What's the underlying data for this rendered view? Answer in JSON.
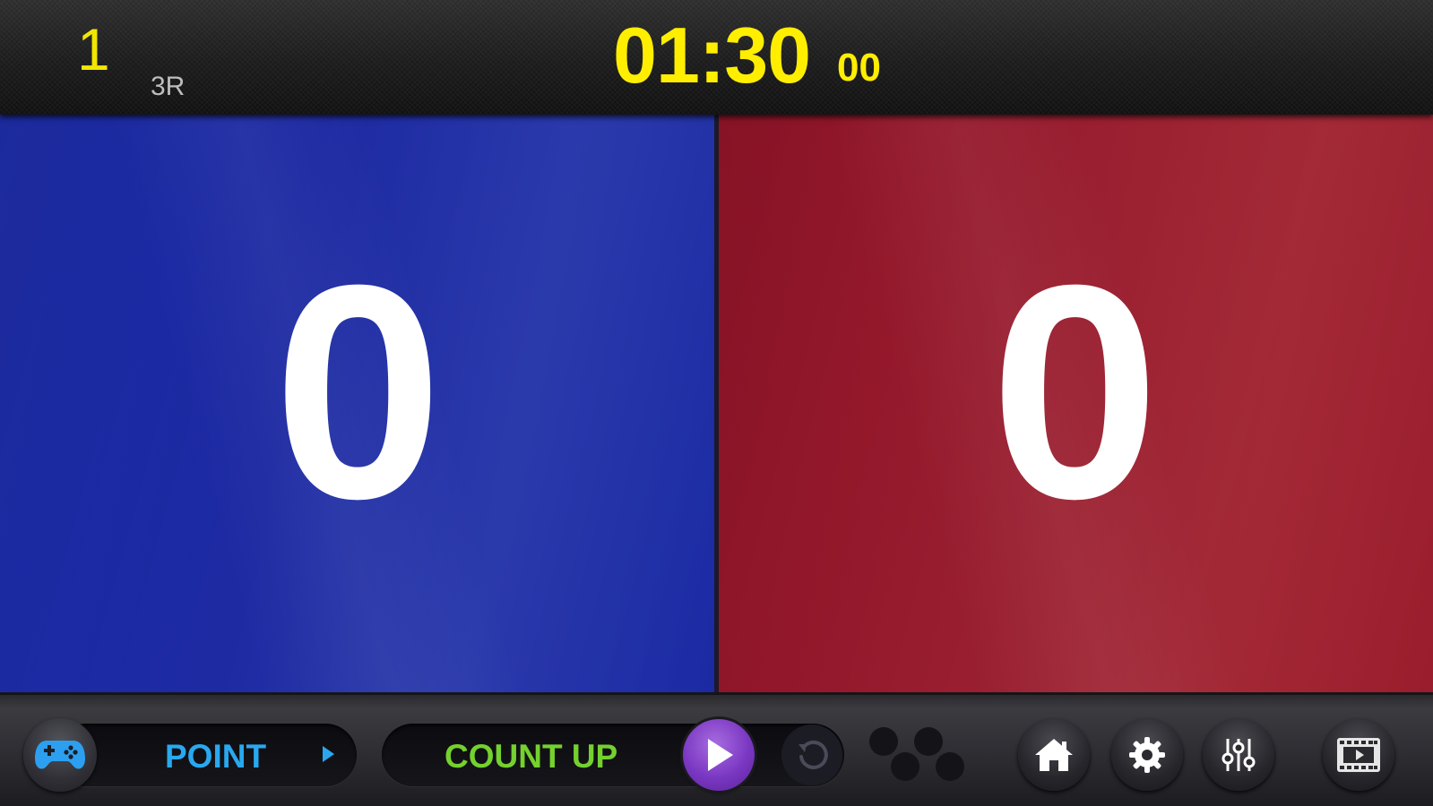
{
  "header": {
    "period": "1",
    "round": "3R",
    "timer": "01:30",
    "timer_fraction": "00"
  },
  "scores": {
    "blue": "0",
    "red": "0"
  },
  "colors": {
    "blue_team": "#1d2da6",
    "red_team": "#961a2c",
    "timer": "#ffee00",
    "point_label": "#29a8f0",
    "count_label": "#74d12e",
    "play_button": "#7a38c2"
  },
  "toolbar": {
    "mode_label": "POINT",
    "timer_mode_label": "COUNT UP",
    "icons": [
      "gamepad-icon",
      "play-icon",
      "reset-icon",
      "dots-icon",
      "home-icon",
      "gear-icon",
      "mixer-icon",
      "media-icon"
    ]
  }
}
